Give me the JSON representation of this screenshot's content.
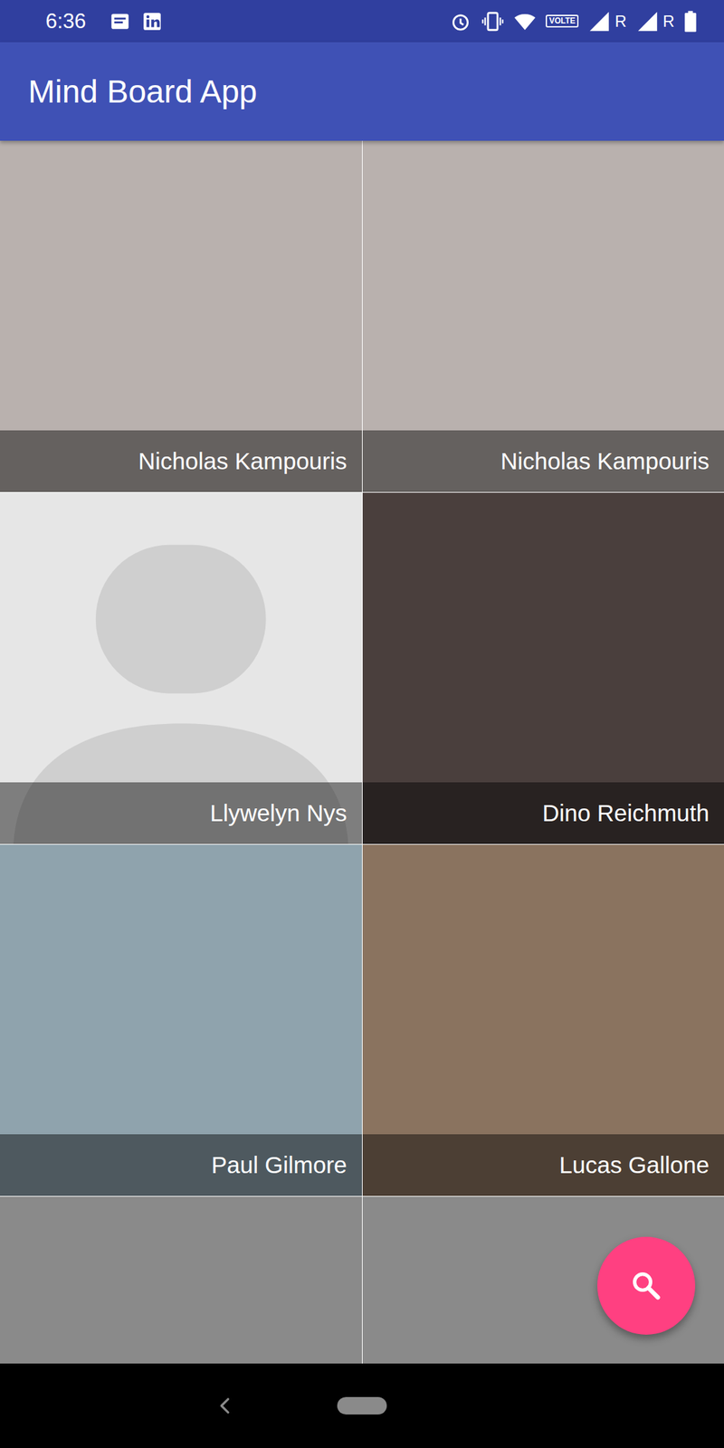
{
  "status_bar": {
    "time": "6:36",
    "network": "VOLTE",
    "roaming": [
      "R",
      "R"
    ]
  },
  "app_bar": {
    "title": "Mind Board App"
  },
  "tiles": [
    {
      "name": "Nicholas Kampouris",
      "kind": "photo",
      "color": "#b9b1ae"
    },
    {
      "name": "Nicholas Kampouris",
      "kind": "photo",
      "color": "#b9b1ae"
    },
    {
      "name": "Llywelyn Nys",
      "kind": "placeholder",
      "color": "#e6e6e6"
    },
    {
      "name": "Dino Reichmuth",
      "kind": "photo",
      "color": "#4a3f3d"
    },
    {
      "name": "Paul Gilmore",
      "kind": "photo",
      "color": "#8fa3ad"
    },
    {
      "name": "Lucas Gallone",
      "kind": "photo",
      "color": "#8a735f"
    },
    {
      "kind": "photo",
      "color": "#8a8a8a"
    },
    {
      "kind": "photo",
      "color": "#8a8a8a"
    }
  ]
}
